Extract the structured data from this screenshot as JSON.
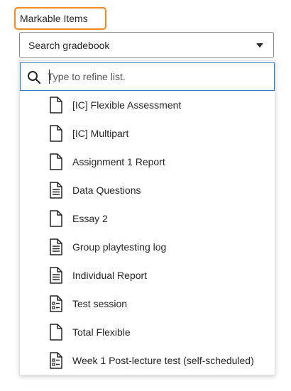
{
  "field": {
    "label": "Markable Items",
    "selected_value": "Search gradebook"
  },
  "search": {
    "placeholder": "Type to refine list."
  },
  "items": [
    {
      "label": "[IC] Flexible Assessment",
      "icon": "blank-document-icon"
    },
    {
      "label": "[IC] Multipart",
      "icon": "blank-document-icon"
    },
    {
      "label": "Assignment 1 Report",
      "icon": "blank-document-icon"
    },
    {
      "label": "Data Questions",
      "icon": "text-document-icon"
    },
    {
      "label": "Essay 2",
      "icon": "blank-document-icon"
    },
    {
      "label": "Group playtesting log",
      "icon": "text-document-icon"
    },
    {
      "label": "Individual Report",
      "icon": "text-document-icon"
    },
    {
      "label": "Test session",
      "icon": "test-document-icon"
    },
    {
      "label": "Total Flexible",
      "icon": "blank-document-icon"
    },
    {
      "label": "Week 1 Post-lecture test (self-scheduled)",
      "icon": "test-document-icon"
    }
  ],
  "colors": {
    "focus_highlight": "#f08a24",
    "search_border": "#3b73b9"
  }
}
